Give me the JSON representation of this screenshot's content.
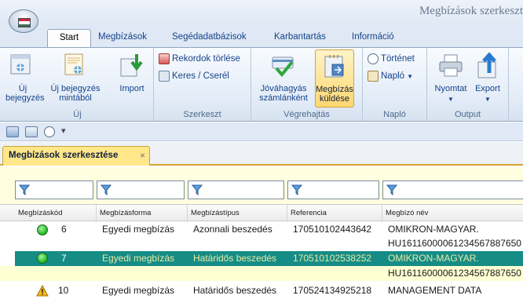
{
  "window": {
    "title": "Megbízások szerkeszt"
  },
  "ribbon_tabs": [
    "Start",
    "Megbízások",
    "Segédadatbázisok",
    "Karbantartás",
    "Információ"
  ],
  "ribbon": {
    "groups": {
      "uj": "Új",
      "szerkeszt": "Szerkeszt",
      "vegrehajtas": "Végrehajtás",
      "naplo": "Napló",
      "output": "Output"
    },
    "uj_label": "Új\nbejegyzés",
    "uj_mintabol_label": "Új bejegyzés\nmintából",
    "import_label": "Import",
    "rekordok_torlese": "Rekordok törlése",
    "keres_csere": "Keres / Cserél",
    "jovahagyas_label": "Jóváhagyás\nszámlánként",
    "megbizas_kuldese_label": "Megbízás\nküldése",
    "tortenet": "Történet",
    "naplo": "Napló",
    "nyomtat": "Nyomtat",
    "export": "Export"
  },
  "document_tab": {
    "label": "Megbízások szerkesztése",
    "close": "×"
  },
  "grid": {
    "headers": [
      "Megbízáskód",
      "Megbízásforma",
      "Megbízástípus",
      "Referencia",
      "Megbízó név"
    ],
    "rows": [
      {
        "kod": "6",
        "forma": "Egyedi megbízás",
        "tipus": "Azonnali beszedés",
        "referencia": "170510102443642",
        "nev": "OMIKRON-MAGYAR.",
        "nev2": "HU16116000061234567887650",
        "status": "green"
      },
      {
        "kod": "7",
        "forma": "Egyedi megbízás",
        "tipus": "Határidős beszedés",
        "referencia": "170510102538252",
        "nev": "OMIKRON-MAGYAR.",
        "nev2": "HU16116000061234567887650",
        "status": "green"
      },
      {
        "kod": "10",
        "forma": "Egyedi megbízás",
        "tipus": "Határidős beszedés",
        "referencia": "170524134925218",
        "nev": "MANAGEMENT DATA",
        "nev2": "",
        "status": "warning"
      }
    ]
  },
  "colors": {
    "selected_row": "#158d86",
    "selected_text": "#e9e9a6",
    "status_green": "#2fbf2f",
    "warning": "#f1b81e"
  }
}
